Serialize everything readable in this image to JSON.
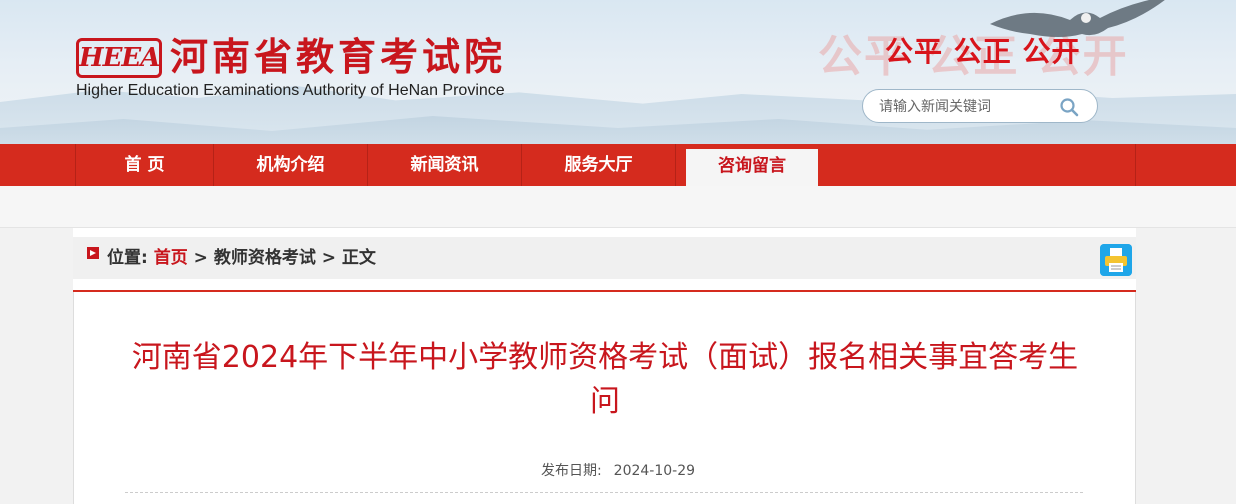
{
  "header": {
    "logo_mark": "HEEA",
    "site_name_cn": "河南省教育考试院",
    "site_name_en": "Higher Education Examinations Authority of HeNan Province",
    "slogan": "公平 公正 公开",
    "search": {
      "placeholder": "请输入新闻关键词"
    }
  },
  "nav": {
    "items": [
      {
        "label": "首 页"
      },
      {
        "label": "机构介绍"
      },
      {
        "label": "新闻资讯"
      },
      {
        "label": "服务大厅"
      },
      {
        "label": "咨询留言",
        "active": true
      }
    ]
  },
  "breadcrumb": {
    "prefix": "位置:",
    "home": "首页",
    "sep1": ">",
    "category": "教师资格考试",
    "sep2": ">",
    "current": "正文"
  },
  "article": {
    "title": "河南省2024年下半年中小学教师资格考试（面试）报名相关事宜答考生问",
    "date_label": "发布日期:",
    "date_value": "2024-10-29"
  },
  "colors": {
    "brand_red": "#d52b1e",
    "title_red": "#c8161d"
  },
  "icons": [
    "search-icon",
    "print-icon",
    "eagle-graphic"
  ]
}
